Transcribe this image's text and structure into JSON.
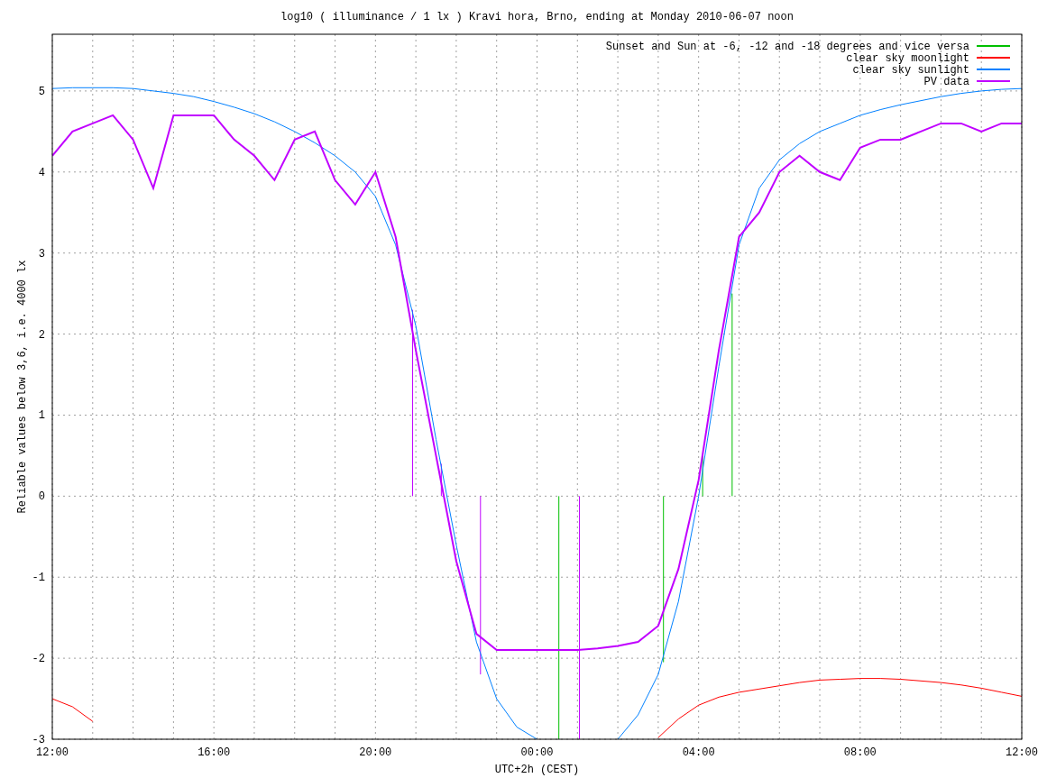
{
  "figure": {
    "chart_data": {
      "type": "line",
      "title": "log10 ( illuminance / 1 lx ) Kravi hora, Brno, ending at Monday 2010-06-07 noon",
      "xlabel": "UTC+2h (CEST)",
      "ylabel": "Reliable values below 3,6, i.e. 4000 lx",
      "categories": [
        "12:00",
        null,
        null,
        null,
        null,
        null,
        null,
        null,
        "16:00",
        null,
        null,
        null,
        null,
        null,
        null,
        null,
        "20:00",
        null,
        null,
        null,
        null,
        null,
        null,
        null,
        "00:00",
        null,
        null,
        null,
        null,
        null,
        null,
        null,
        "04:00",
        null,
        null,
        null,
        null,
        null,
        null,
        null,
        "08:00",
        null,
        null,
        null,
        null,
        null,
        null,
        null,
        "12:00"
      ],
      "ylim": [
        -3,
        5.7
      ],
      "yticks": [
        -3,
        -2,
        -1,
        0,
        1,
        2,
        3,
        4,
        5
      ],
      "grid": true,
      "legend": true,
      "series": [
        {
          "name": "Sunset and Sun at -6, -12 and -18 degrees and vice versa",
          "color": "#00c000",
          "values": [
            null,
            null,
            null,
            null,
            null,
            null,
            null,
            null,
            null,
            null,
            null,
            null,
            null,
            null,
            null,
            null,
            null,
            null,
            null,
            null,
            null,
            null,
            null,
            null,
            null,
            null,
            null,
            null,
            null,
            null,
            null,
            null,
            null,
            null,
            null,
            null,
            null,
            null,
            null,
            null,
            null,
            null,
            null,
            null,
            null,
            null,
            null,
            null,
            null
          ]
        },
        {
          "name": "clear sky moonlight",
          "color": "#ff0000",
          "values": [
            -2.5,
            -2.6,
            -2.78,
            null,
            null,
            null,
            null,
            null,
            null,
            null,
            null,
            null,
            null,
            null,
            null,
            null,
            null,
            null,
            null,
            null,
            null,
            null,
            null,
            null,
            null,
            null,
            null,
            null,
            null,
            null,
            -2.98,
            -2.75,
            -2.58,
            -2.48,
            -2.42,
            -2.38,
            -2.34,
            -2.3,
            -2.27,
            -2.26,
            -2.25,
            -2.25,
            -2.26,
            -2.28,
            -2.3,
            -2.33,
            -2.37,
            -2.42,
            -2.47
          ]
        },
        {
          "name": "clear sky sunlight",
          "color": "#0080ff",
          "values": [
            5.03,
            5.04,
            5.04,
            5.04,
            5.03,
            5.0,
            4.97,
            4.93,
            4.87,
            4.8,
            4.72,
            4.62,
            4.5,
            4.36,
            4.2,
            4.0,
            3.7,
            3.1,
            2.1,
            0.7,
            -0.6,
            -1.8,
            -2.5,
            -2.85,
            -3.0,
            null,
            null,
            null,
            -3.0,
            -2.7,
            -2.2,
            -1.3,
            0.0,
            1.6,
            3.1,
            3.8,
            4.15,
            4.35,
            4.5,
            4.6,
            4.7,
            4.77,
            4.83,
            4.88,
            4.93,
            4.97,
            5.0,
            5.02,
            5.03
          ]
        },
        {
          "name": "PV data",
          "color": "#c000ff",
          "values": [
            4.2,
            4.5,
            4.6,
            4.7,
            4.4,
            3.8,
            4.7,
            4.7,
            4.7,
            4.4,
            4.2,
            3.9,
            4.4,
            4.5,
            3.9,
            3.6,
            4.0,
            3.2,
            1.8,
            0.5,
            -0.8,
            -1.7,
            -1.9,
            -1.9,
            -1.9,
            -1.9,
            -1.9,
            -1.88,
            -1.85,
            -1.8,
            -1.6,
            -0.9,
            0.2,
            1.8,
            3.2,
            3.5,
            4.0,
            4.2,
            4.0,
            3.9,
            4.3,
            4.4,
            4.4,
            4.5,
            4.6,
            4.6,
            4.5,
            4.6,
            4.6
          ]
        }
      ]
    }
  }
}
